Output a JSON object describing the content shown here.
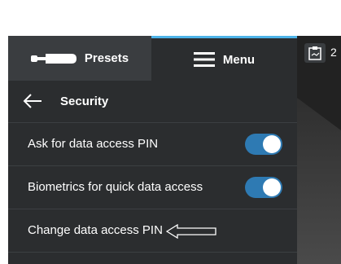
{
  "tabs": {
    "presets_label": "Presets",
    "menu_label": "Menu"
  },
  "header": {
    "title": "Security"
  },
  "settings": {
    "items": [
      {
        "label": "Ask for data access PIN",
        "toggle_on": true
      },
      {
        "label": "Biometrics for quick data access",
        "toggle_on": true
      },
      {
        "label": "Change data access PIN"
      }
    ]
  },
  "side": {
    "count": "2"
  },
  "colors": {
    "panel_bg": "#2b2d2f",
    "presets_tab_bg": "#3a3d40",
    "accent": "#4db3e8",
    "toggle_on": "#2e7ab3"
  },
  "icons": {
    "probe": "probe-icon",
    "menu": "hamburger-menu-icon",
    "back": "back-arrow-icon",
    "clipboard": "clipboard-icon",
    "annotation": "left-pointing-arrow-annotation"
  }
}
